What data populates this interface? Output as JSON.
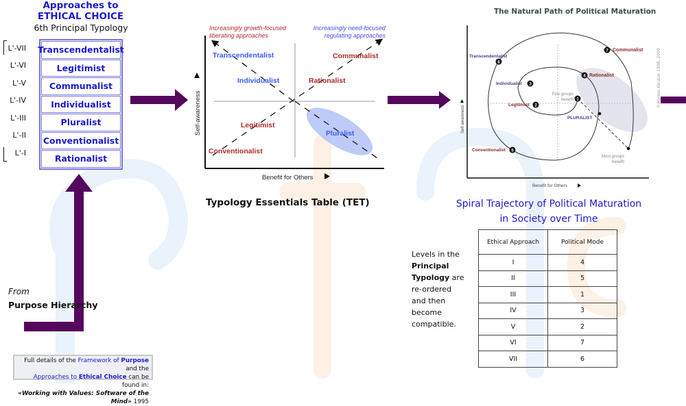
{
  "colors": {
    "arrow": "#55075e",
    "blue_text": "#1a1acc",
    "red_text": "#b32a2a",
    "light_blue_text": "#3b5bff",
    "ellipse_blue": "#aebdf5",
    "ellipse_grey": "#e4e4ee"
  },
  "typology": {
    "title_line1": "Approaches to",
    "title_line2": "ETHICAL CHOICE",
    "subtitle": "6th Principal Typology",
    "rows": [
      {
        "level": "L'-VII",
        "name": "Transcendentalist"
      },
      {
        "level": "L'-VI",
        "name": "Legitimist"
      },
      {
        "level": "L'-V",
        "name": "Communalist"
      },
      {
        "level": "L'-IV",
        "name": "Individualist"
      },
      {
        "level": "L'-III",
        "name": "Pluralist"
      },
      {
        "level": "L'-II",
        "name": "Conventionalist"
      },
      {
        "level": "L'-I",
        "name": "Rationalist"
      }
    ]
  },
  "source": {
    "from": "From",
    "purpose_hierarchy": "Purpose Hierarchy"
  },
  "note": {
    "line1_a": "Full details of the ",
    "line1_b": "Framework of ",
    "line1_c": "Purpose",
    "line1_d": " and the",
    "line2_a": "Approaches to ",
    "line2_b": "Ethical Choice",
    "line2_c": " can be found in:",
    "line3_a": "«Working with Values: Software of the Mind»",
    "line3_b": " 1995"
  },
  "tet": {
    "top_left_note_1": "Increasingly growth-focused",
    "top_left_note_2": "liberating approaches",
    "top_right_note_1": "Increasingly need-focused",
    "top_right_note_2": "regulating approaches",
    "y_axis": "Self-awareness",
    "x_axis": "Benefit for Others",
    "labels": {
      "transcendentalist": "Transcendentalist",
      "individualist": "Individualist",
      "communalist": "Communalist",
      "rationalist": "Rationalist",
      "legitimist": "Legitimist",
      "conventionalist": "Conventionalist",
      "pluralist": "Pluralist"
    },
    "caption": "Typology Essentials Table (TET)"
  },
  "spiral": {
    "title": "The Natural Path of Political Maturation",
    "y_axis": "Self-awareness",
    "x_axis": "Benefit for Others",
    "nodes": [
      {
        "n": "1",
        "label": "Few groups benefit"
      },
      {
        "n": "2",
        "label": "Legitimist"
      },
      {
        "n": "3",
        "label": "Individualist"
      },
      {
        "n": "4",
        "label": "Rationalist"
      },
      {
        "n": "5",
        "label": "Conventionalist"
      },
      {
        "n": "6",
        "label": "Transcendentalist"
      },
      {
        "n": "7",
        "label": "Communalist"
      }
    ],
    "few_groups_1": "Few groups",
    "few_groups_2": "benefit",
    "most_groups_1": "Most groups",
    "most_groups_2": "benefit",
    "pluralist": "PLURALIST",
    "copyright": "©Warren Kinston 1998, 2009",
    "caption_line1": "Spiral Trajectory of Political Maturation",
    "caption_line2": "in Society over Time"
  },
  "levels_note": {
    "t1": "Levels in the ",
    "t2": "Principal Typology",
    "t3": " are re-ordered and then become compatible."
  },
  "mapping_table": {
    "headers": [
      "Ethical Approach",
      "Political Mode"
    ],
    "rows": [
      [
        "I",
        "4"
      ],
      [
        "II",
        "5"
      ],
      [
        "III",
        "1"
      ],
      [
        "IV",
        "3"
      ],
      [
        "V",
        "2"
      ],
      [
        "VI",
        "7"
      ],
      [
        "VII",
        "6"
      ]
    ]
  }
}
